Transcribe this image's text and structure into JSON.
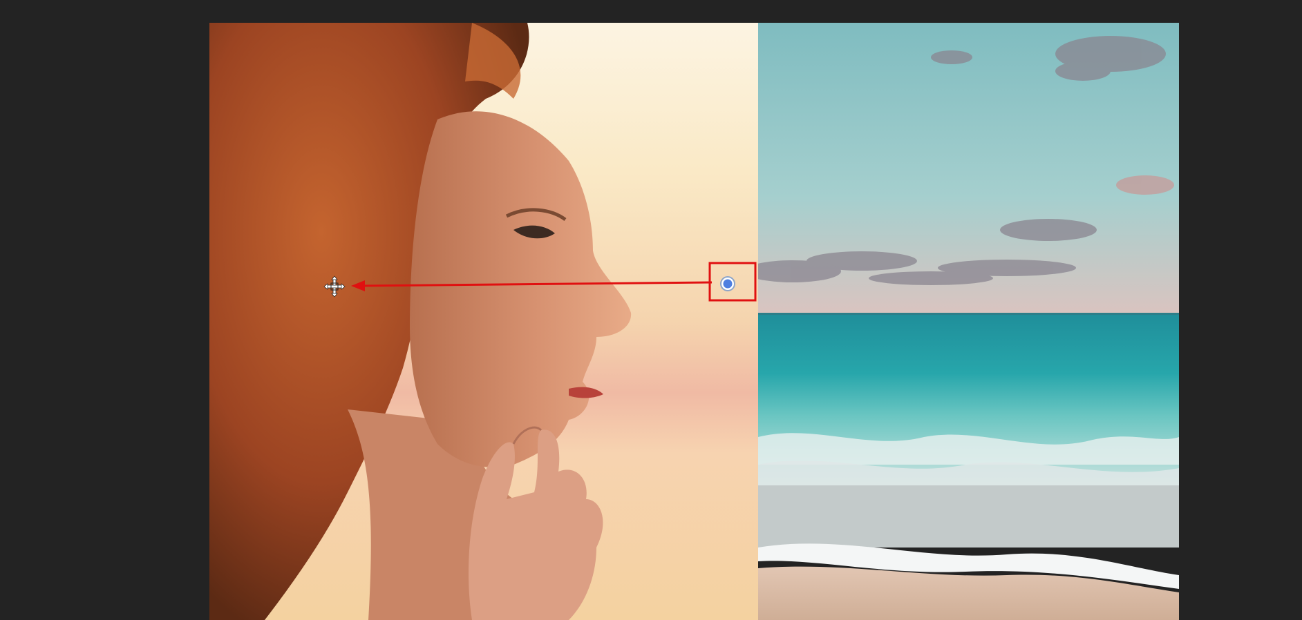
{
  "app": {
    "canvas_background": "#232323"
  },
  "document": {
    "left_image": {
      "subject": "woman-profile-portrait",
      "palette": {
        "sky_top": "#fbf1dc",
        "sky_mid": "#f7d9b2",
        "sky_low": "#efb9a2",
        "hair": "#b5532a",
        "skin": "#d99573"
      }
    },
    "right_image": {
      "subject": "beach-seascape",
      "palette": {
        "sky": "#93c7c9",
        "sea": "#24a5a8",
        "foam": "#e8eeee",
        "sand": "#d8b8a2"
      }
    }
  },
  "annotation": {
    "arrow_color": "#e01010",
    "highlight_box_color": "#e01010",
    "control_point_color": "#4f7fe0",
    "arrow_icon": "arrow-left-icon",
    "cursor_icon": "crosshair-move-cursor-icon"
  }
}
